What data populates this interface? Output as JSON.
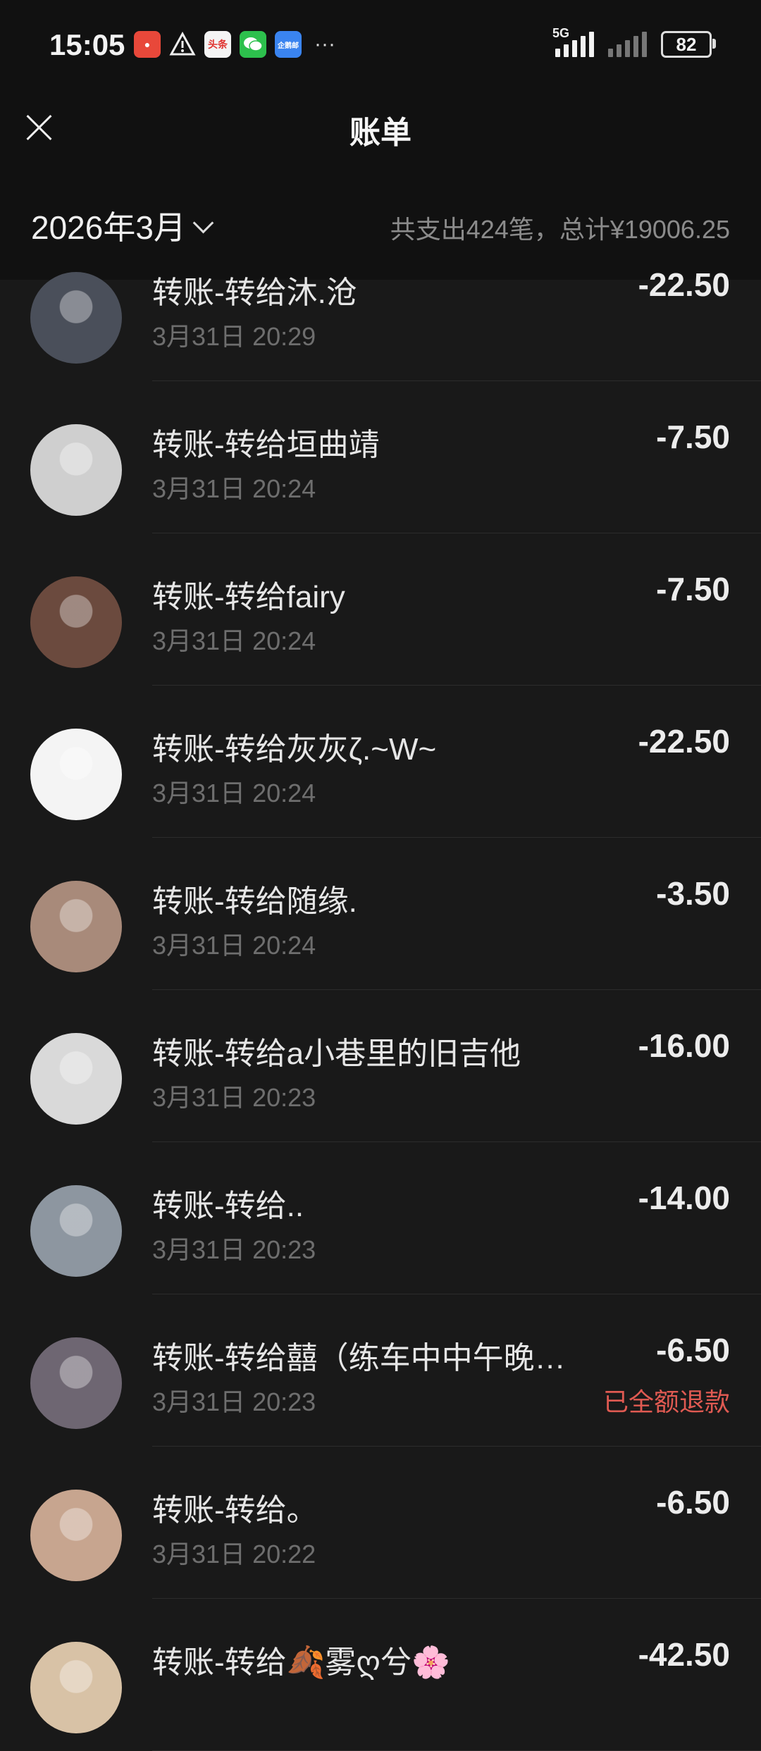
{
  "status_bar": {
    "time": "15:05",
    "network": "5G",
    "battery": "82",
    "more": "···",
    "app_icons": [
      "app-icon-red",
      "warning-icon",
      "toutiao-icon",
      "wechat-icon",
      "qiyeweixin-icon"
    ],
    "toutiao_label": "头条",
    "qq_label": "企鹅邮"
  },
  "nav": {
    "title": "账单"
  },
  "filter": {
    "month": "2026年3月",
    "summary": "共支出424笔，总计¥19006.25"
  },
  "transactions": [
    {
      "title": "转账-转给沐.沧",
      "time": "3月31日 20:29",
      "amount": "-22.50",
      "status": "",
      "avatar_color": "#4a4f5a"
    },
    {
      "title": "转账-转给垣曲靖",
      "time": "3月31日 20:24",
      "amount": "-7.50",
      "status": "",
      "avatar_color": "#cfcfcf"
    },
    {
      "title": "转账-转给fairy",
      "time": "3月31日 20:24",
      "amount": "-7.50",
      "status": "",
      "avatar_color": "#6b4a3e"
    },
    {
      "title": "转账-转给灰灰ζ.~W~",
      "time": "3月31日 20:24",
      "amount": "-22.50",
      "status": "",
      "avatar_color": "#f4f4f4"
    },
    {
      "title": "转账-转给随缘.",
      "time": "3月31日 20:24",
      "amount": "-3.50",
      "status": "",
      "avatar_color": "#a88a7a"
    },
    {
      "title": "转账-转给a小巷里的旧吉他",
      "time": "3月31日 20:23",
      "amount": "-16.00",
      "status": "",
      "avatar_color": "#d9d9d9"
    },
    {
      "title": "转账-转给..",
      "time": "3月31日 20:23",
      "amount": "-14.00",
      "status": "",
      "avatar_color": "#8d96a0"
    },
    {
      "title": "转账-转给囍（练车中中午晚…",
      "time": "3月31日 20:23",
      "amount": "-6.50",
      "status": "已全额退款",
      "avatar_color": "#6e6672"
    },
    {
      "title": "转账-转给。",
      "time": "3月31日 20:22",
      "amount": "-6.50",
      "status": "",
      "avatar_color": "#c7a58f"
    },
    {
      "title": "转账-转给🍂雾ღ兮🌸",
      "time": "",
      "amount": "-42.50",
      "status": "",
      "avatar_color": "#d8c2a6"
    }
  ]
}
